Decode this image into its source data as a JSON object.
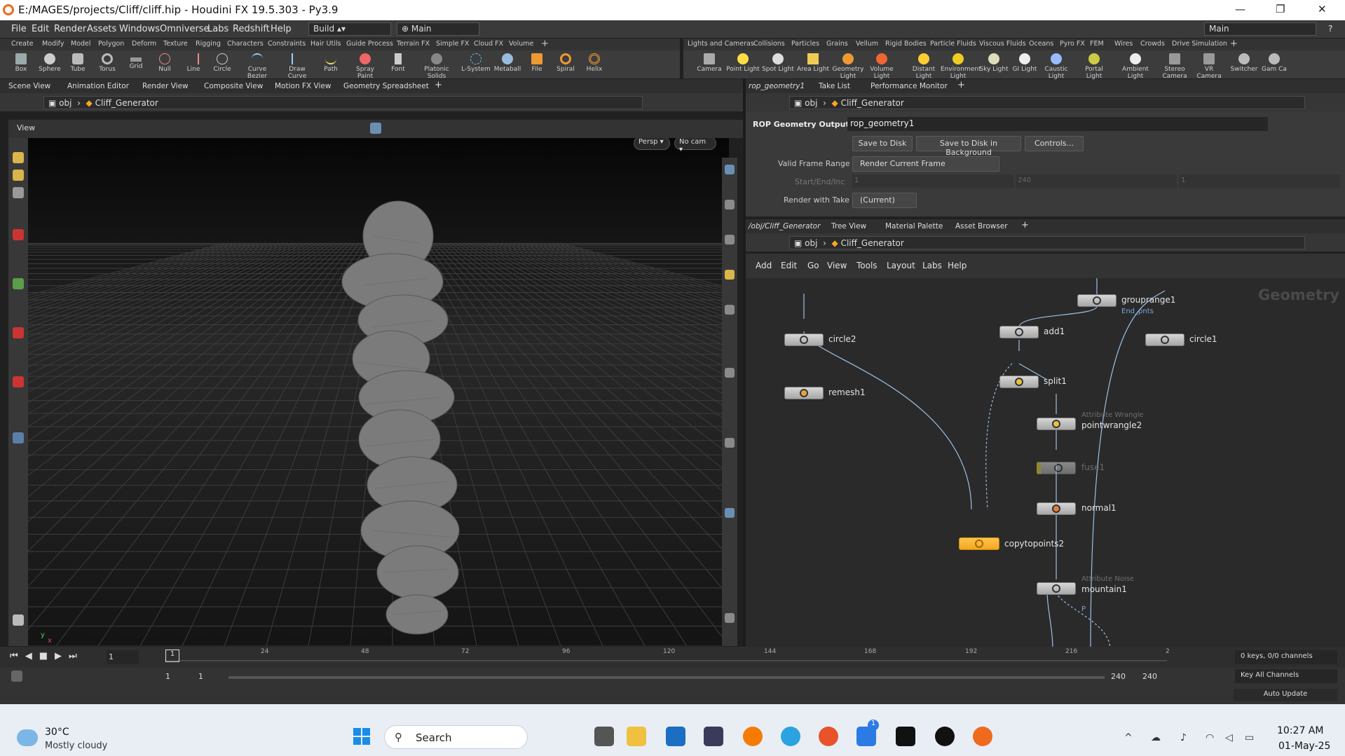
{
  "window": {
    "title": "E:/MAGES/projects/Cliff/cliff.hip - Houdini FX 19.5.303 - Py3.9",
    "controls": [
      "—",
      "❐",
      "✕"
    ]
  },
  "menu": {
    "items": [
      "File",
      "Edit",
      "Render",
      "Assets",
      "Windows",
      "Omniverse",
      "Labs",
      "Redshift",
      "Help"
    ],
    "build": "Build",
    "main": "Main",
    "desktop": "Main"
  },
  "shelf_tabs_left": [
    "Create",
    "Modify",
    "Model",
    "Polygon",
    "Deform",
    "Texture",
    "Rigging",
    "Characters",
    "Constraints",
    "Hair Utils",
    "Guide Process",
    "Terrain FX",
    "Simple FX",
    "Cloud FX",
    "Volume"
  ],
  "shelf_tabs_right": [
    "Lights and Cameras",
    "Collisions",
    "Particles",
    "Grains",
    "Vellum",
    "Rigid Bodies",
    "Particle Fluids",
    "Viscous Fluids",
    "Oceans",
    "Pyro FX",
    "FEM",
    "Wires",
    "Crowds",
    "Drive Simulation"
  ],
  "tools_left": [
    "Box",
    "Sphere",
    "Tube",
    "Torus",
    "Grid",
    "Null",
    "Line",
    "Circle",
    "Curve Bezier",
    "Draw Curve",
    "Path",
    "Spray Paint",
    "Font",
    "Platonic Solids",
    "L-System",
    "Metaball",
    "File",
    "Spiral",
    "Helix"
  ],
  "tools_right": [
    "Camera",
    "Point Light",
    "Spot Light",
    "Area Light",
    "Geometry Light",
    "Volume Light",
    "Distant Light",
    "Environment Light",
    "Sky Light",
    "GI Light",
    "Caustic Light",
    "Portal Light",
    "Ambient Light",
    "Stereo Camera",
    "VR Camera",
    "Switcher",
    "Gam Ca"
  ],
  "left_pane": {
    "tabs": [
      "Scene View",
      "Animation Editor",
      "Render View",
      "Composite View",
      "Motion FX View",
      "Geometry Spreadsheet"
    ],
    "path_obj": "obj",
    "path_node": "Cliff_Generator",
    "view_label": "View",
    "persp": "Persp ▾",
    "cam": "No cam ▾"
  },
  "param_pane": {
    "tabs": [
      "rop_geometry1",
      "Take List",
      "Performance Monitor"
    ],
    "path_obj": "obj",
    "path_node": "Cliff_Generator",
    "node_type": "ROP Geometry Output",
    "node_name": "rop_geometry1",
    "buttons": [
      "Save to Disk",
      "Save to Disk in Background",
      "Controls..."
    ],
    "valid_frame_range_label": "Valid Frame Range",
    "valid_frame_range_value": "Render Current Frame",
    "start_end_label": "Start/End/Inc",
    "start": "1",
    "end": "240",
    "inc": "1",
    "render_take_label": "Render with Take",
    "render_take_value": "(Current)"
  },
  "network_pane": {
    "tabs": [
      "/obj/Cliff_Generator",
      "Tree View",
      "Material Palette",
      "Asset Browser"
    ],
    "path_obj": "obj",
    "path_node": "Cliff_Generator",
    "menu": [
      "Add",
      "Edit",
      "Go",
      "View",
      "Tools",
      "Layout",
      "Labs",
      "Help"
    ],
    "context": "Geometry",
    "nodes": [
      {
        "name": "grouprange1",
        "sub": "End_pnts"
      },
      {
        "name": "add1",
        "sub": ""
      },
      {
        "name": "circle2",
        "sub": ""
      },
      {
        "name": "circle1",
        "sub": ""
      },
      {
        "name": "remesh1",
        "sub": ""
      },
      {
        "name": "split1",
        "sub": ""
      },
      {
        "name": "pointwrangle2",
        "sub": "Attribute Wrangle"
      },
      {
        "name": "fuse1",
        "sub": ""
      },
      {
        "name": "normal1",
        "sub": ""
      },
      {
        "name": "copytopoints2",
        "sub": ""
      },
      {
        "name": "mountain1",
        "sub": "Attribute Noise"
      }
    ],
    "extra_label": "P"
  },
  "timeline": {
    "ticks": [
      "24",
      "48",
      "72",
      "96",
      "120",
      "144",
      "168",
      "192",
      "216",
      "2"
    ],
    "current_frame": "1",
    "frame_marker": "1",
    "range_start": "1",
    "range_start2": "1",
    "range_end": "240",
    "range_end2": "240",
    "keys_info": "0 keys, 0/0 channels",
    "key_all": "Key All Channels",
    "auto_update": "Auto Update"
  },
  "taskbar": {
    "temp": "30°C",
    "weather": "Mostly cloudy",
    "search": "Search",
    "time": "10:27 AM",
    "date": "01-May-25",
    "badge": "1"
  },
  "colors": {
    "accent": "#f5a623",
    "houdini": "#f06a1d"
  }
}
